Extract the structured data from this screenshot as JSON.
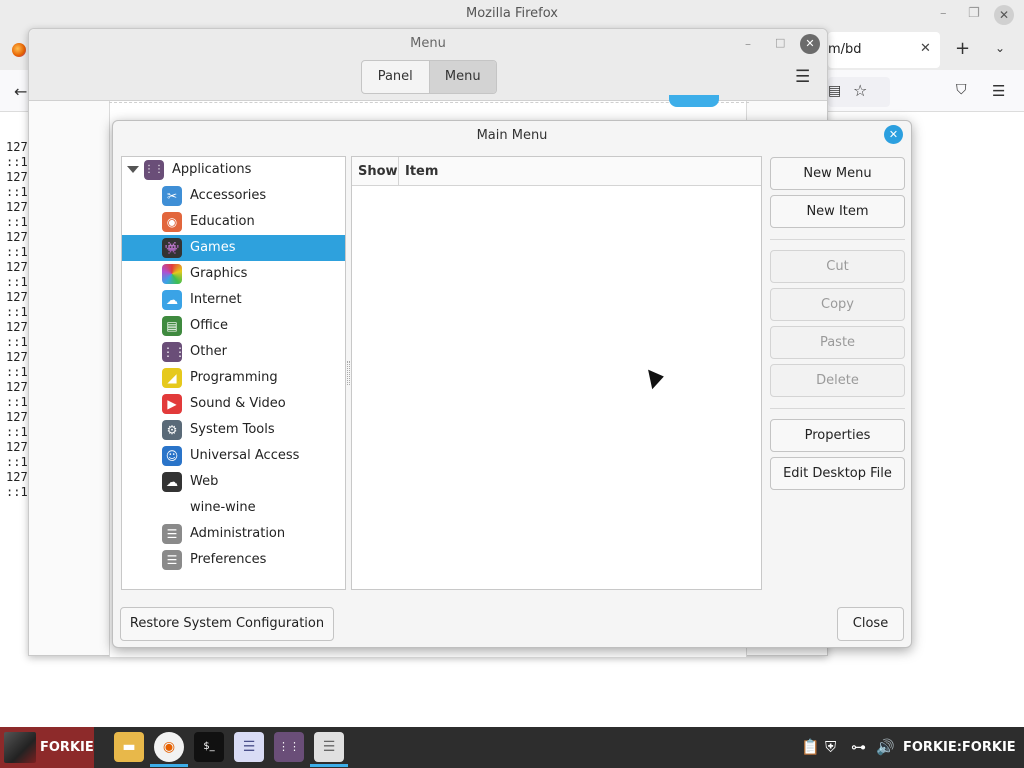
{
  "firefox": {
    "window_title": "Mozilla Firefox",
    "tab_title": "m/bd",
    "content_lines": [
      "127",
      "::1",
      "127",
      "::1",
      "127",
      "::1",
      "127",
      "::1",
      "127",
      "::1",
      "127",
      "::1",
      "127",
      "::1",
      "127",
      "::1",
      "127",
      "::1",
      "127",
      "::1",
      "127",
      "::1",
      "127",
      "::1"
    ]
  },
  "menu_window": {
    "title": "Menu",
    "tabs": [
      {
        "label": "Panel",
        "active": false
      },
      {
        "label": "Menu",
        "active": true
      }
    ]
  },
  "main_menu": {
    "title": "Main Menu",
    "tree": {
      "root_label": "Applications",
      "items": [
        {
          "label": "Accessories",
          "icon": "accessories-icon",
          "color": "#3f8fd6",
          "glyph": "✂",
          "selected": false
        },
        {
          "label": "Education",
          "icon": "education-icon",
          "color": "#e2663c",
          "glyph": "◉",
          "selected": false
        },
        {
          "label": "Games",
          "icon": "games-icon",
          "color": "#333333",
          "glyph": "👾",
          "selected": true
        },
        {
          "label": "Graphics",
          "icon": "graphics-icon",
          "color": "#b04fd1",
          "glyph": "",
          "selected": false
        },
        {
          "label": "Internet",
          "icon": "internet-icon",
          "color": "#3aa3e6",
          "glyph": "☁",
          "selected": false
        },
        {
          "label": "Office",
          "icon": "office-icon",
          "color": "#3f8a3f",
          "glyph": "▤",
          "selected": false
        },
        {
          "label": "Other",
          "icon": "other-icon",
          "color": "#6a4e78",
          "glyph": "⋮⋮",
          "selected": false
        },
        {
          "label": "Programming",
          "icon": "programming-icon",
          "color": "#e6c91c",
          "glyph": "◢",
          "selected": false
        },
        {
          "label": "Sound & Video",
          "icon": "sound-video-icon",
          "color": "#e23a3a",
          "glyph": "▶",
          "selected": false
        },
        {
          "label": "System Tools",
          "icon": "system-tools-icon",
          "color": "#5a6a78",
          "glyph": "⚙",
          "selected": false
        },
        {
          "label": "Universal Access",
          "icon": "universal-access-icon",
          "color": "#2a74c9",
          "glyph": "☺",
          "selected": false
        },
        {
          "label": "Web",
          "icon": "web-icon",
          "color": "#333333",
          "glyph": "☁",
          "selected": false
        },
        {
          "label": "wine-wine",
          "icon": "",
          "color": "",
          "glyph": "",
          "selected": false
        },
        {
          "label": "Administration",
          "icon": "administration-icon",
          "color": "#8a8a8a",
          "glyph": "☰",
          "selected": false
        },
        {
          "label": "Preferences",
          "icon": "preferences-icon",
          "color": "#8a8a8a",
          "glyph": "☰",
          "selected": false
        }
      ]
    },
    "columns": {
      "show": "Show",
      "item": "Item"
    },
    "buttons": {
      "new_menu": "New Menu",
      "new_item": "New Item",
      "cut": "Cut",
      "copy": "Copy",
      "paste": "Paste",
      "delete": "Delete",
      "properties": "Properties",
      "edit_desktop_file": "Edit Desktop File",
      "restore": "Restore System Configuration",
      "close": "Close"
    }
  },
  "taskbar": {
    "start_label": "FORKIE",
    "tray_text": "FORKIE:FORKIE",
    "accent_color": "#3daee9"
  }
}
